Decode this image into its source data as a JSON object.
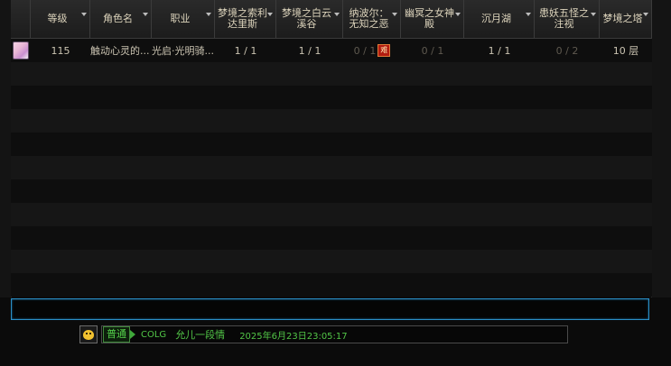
{
  "columns": [
    {
      "key": "icon",
      "label": "",
      "width": 22
    },
    {
      "key": "level",
      "label": "等级",
      "width": 66
    },
    {
      "key": "name",
      "label": "角色名",
      "width": 68
    },
    {
      "key": "job",
      "label": "职业",
      "width": 70
    },
    {
      "key": "d1",
      "label": "梦境之索利达里斯",
      "width": 68
    },
    {
      "key": "d2",
      "label": "梦境之白云溪谷",
      "width": 74
    },
    {
      "key": "d3",
      "label": "纳波尔：无知之恶",
      "width": 64
    },
    {
      "key": "d4",
      "label": "幽冥之女神殿",
      "width": 70
    },
    {
      "key": "d5",
      "label": "沉月湖",
      "width": 78
    },
    {
      "key": "d6",
      "label": "患妖五怪之注视",
      "width": 72
    },
    {
      "key": "d7",
      "label": "梦境之塔",
      "width": 58
    }
  ],
  "rows": [
    {
      "level": "115",
      "name": "触动心灵的...",
      "job": "光启·光明骑...",
      "d1": "1 / 1",
      "d2": "1 / 1",
      "d3": "0 / 1",
      "d3_badge": "难",
      "d4": "0 / 1",
      "d5": "1 / 1",
      "d6": "0 / 2",
      "d7": "10 层"
    }
  ],
  "empty_row_count": 10,
  "chat": {
    "channel": "普通",
    "sender": "COLG",
    "message": "允儿一段情",
    "timestamp": "2025年6月23日23:05:17"
  }
}
